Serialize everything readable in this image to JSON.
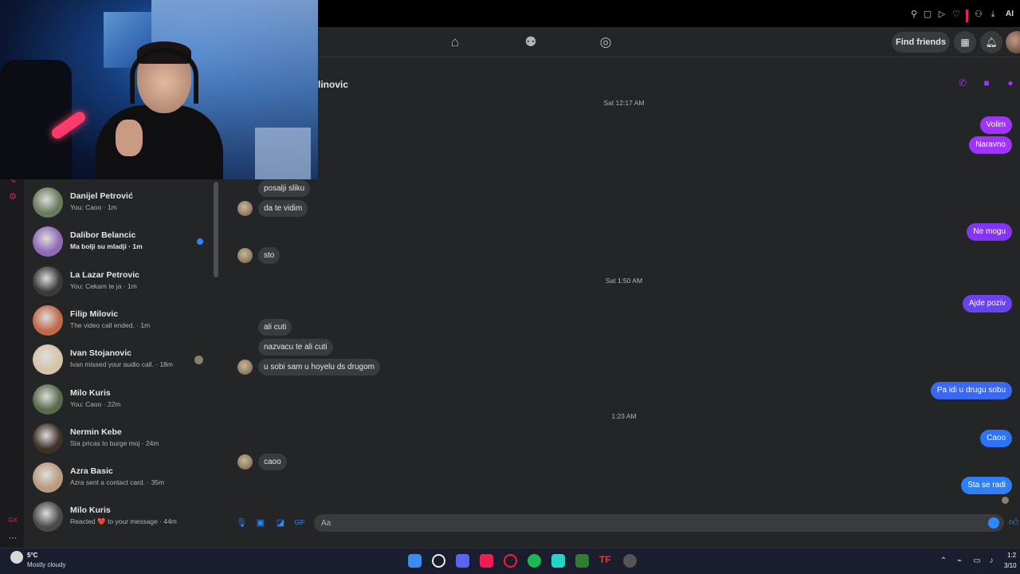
{
  "browser": {
    "ai_label": "AI"
  },
  "fb_nav": {
    "home_icon": "home-icon",
    "friends_icon": "friends-icon",
    "groups_icon": "groups-icon",
    "find_friends": "Find friends"
  },
  "conversation": {
    "name_partial": "linovic",
    "input_placeholder": "Aa",
    "messages": [
      {
        "type": "timestamp",
        "text": "Sat 12:17 AM"
      },
      {
        "type": "out",
        "text": "Volim",
        "color": "#a033ff"
      },
      {
        "type": "out",
        "text": "Naravno",
        "color": "#a033ff"
      },
      {
        "type": "in",
        "text": "posalji sliku"
      },
      {
        "type": "in",
        "text": "da te vidim"
      },
      {
        "type": "out",
        "text": "Ne mogu",
        "color": "#8434f5"
      },
      {
        "type": "in",
        "text": "sto"
      },
      {
        "type": "timestamp",
        "text": "Sat 1:50 AM"
      },
      {
        "type": "out",
        "text": "Ajde poziv",
        "color": "#6a43f0"
      },
      {
        "type": "in",
        "text": "ali cuti"
      },
      {
        "type": "in",
        "text": "nazvacu te ali cuti"
      },
      {
        "type": "in",
        "text": "u sobi sam u hoyelu ds drugom"
      },
      {
        "type": "out",
        "text": "Pa idi u drugu sobu",
        "color": "#3b68f0"
      },
      {
        "type": "timestamp",
        "text": "1:23 AM"
      },
      {
        "type": "out",
        "text": "Caoo",
        "color": "#2d73f5"
      },
      {
        "type": "in",
        "text": "caoo"
      },
      {
        "type": "out",
        "text": "Sta se radi",
        "color": "#2d80f7"
      }
    ]
  },
  "chats": [
    {
      "name": "Danijel Petrović",
      "preview": "You: Caoo · 1m",
      "unread": false
    },
    {
      "name": "Dalibor Belancic",
      "preview": "Ma bolji su mladji · 1m",
      "unread": true
    },
    {
      "name": "La Lazar Petrovic",
      "preview": "You: Cekam te ja · 1m",
      "unread": false
    },
    {
      "name": "Filip Milovic",
      "preview": "The video call ended. · 1m",
      "unread": false
    },
    {
      "name": "Ivan Stojanovic",
      "preview": "Ivan missed your audio call. · 18m",
      "unread": false
    },
    {
      "name": "Milo Kuris",
      "preview": "You: Caoo · 22m",
      "unread": false
    },
    {
      "name": "Nermin Kebe",
      "preview": "Sta pricas to burge moj · 24m",
      "unread": false
    },
    {
      "name": "Azra Basic",
      "preview": "Azra sent a contact card. · 35m",
      "unread": false
    },
    {
      "name": "Milo Kuris",
      "preview": "Reacted ❤️ to your message · 44m",
      "unread": false
    }
  ],
  "taskbar": {
    "temp": "5°C",
    "weather": "Mostly cloudy",
    "time": "1:2",
    "date": "3/10"
  },
  "colors": {
    "accent_blue": "#2d88ff",
    "accent_purple": "#a033ff",
    "bg": "#242526"
  }
}
